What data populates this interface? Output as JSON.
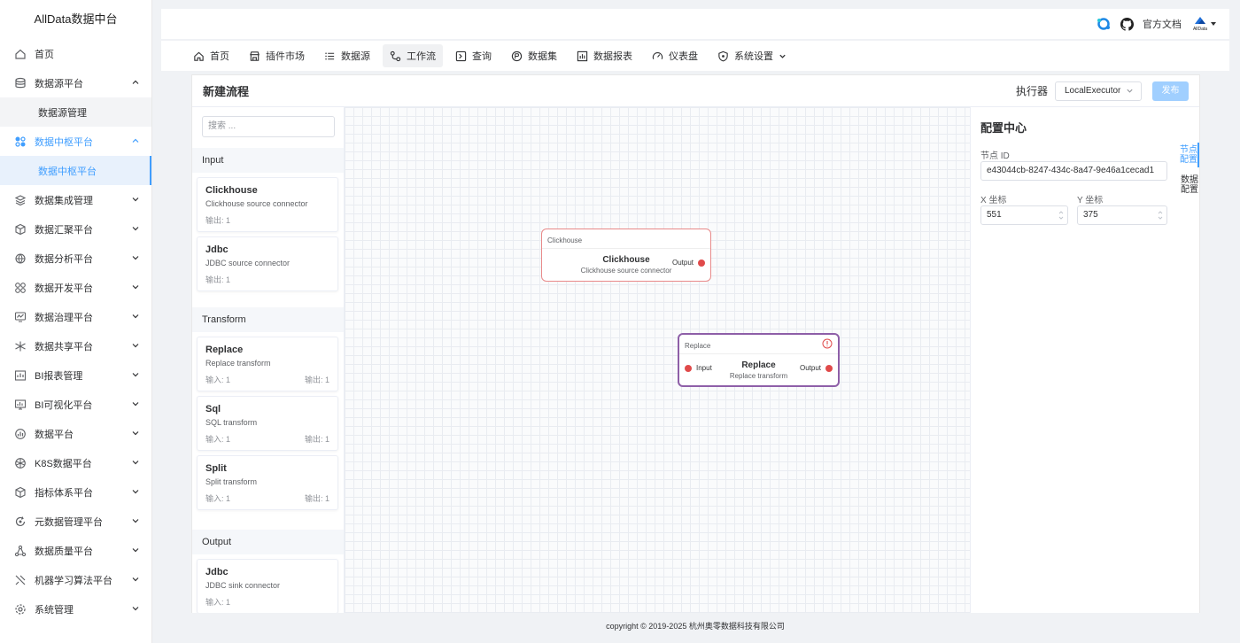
{
  "app": {
    "title": "AllData数据中台"
  },
  "sidebar": {
    "items": [
      {
        "label": "首页"
      },
      {
        "label": "数据源平台"
      },
      {
        "label": "数据源管理"
      },
      {
        "label": "数据中枢平台"
      },
      {
        "label": "数据中枢平台"
      },
      {
        "label": "数据集成管理"
      },
      {
        "label": "数据汇聚平台"
      },
      {
        "label": "数据分析平台"
      },
      {
        "label": "数据开发平台"
      },
      {
        "label": "数据治理平台"
      },
      {
        "label": "数据共享平台"
      },
      {
        "label": "BI报表管理"
      },
      {
        "label": "BI可视化平台"
      },
      {
        "label": "数据平台"
      },
      {
        "label": "K8S数据平台"
      },
      {
        "label": "指标体系平台"
      },
      {
        "label": "元数据管理平台"
      },
      {
        "label": "数据质量平台"
      },
      {
        "label": "机器学习算法平台"
      },
      {
        "label": "系统管理"
      }
    ]
  },
  "header": {
    "docs_label": "官方文档",
    "logo_text": "AllData"
  },
  "menu": {
    "items": [
      {
        "label": "首页"
      },
      {
        "label": "插件市场"
      },
      {
        "label": "数据源"
      },
      {
        "label": "工作流"
      },
      {
        "label": "查询"
      },
      {
        "label": "数据集"
      },
      {
        "label": "数据报表"
      },
      {
        "label": "仪表盘"
      },
      {
        "label": "系统设置"
      }
    ]
  },
  "editor": {
    "title": "新建流程",
    "executor_label": "执行器",
    "executor_value": "LocalExecutor",
    "publish_label": "发布"
  },
  "palette": {
    "search_placeholder": "搜索 ...",
    "groups": [
      {
        "name": "Input",
        "items": [
          {
            "name": "Clickhouse",
            "desc": "Clickhouse source connector",
            "out": "输出: 1"
          },
          {
            "name": "Jdbc",
            "desc": "JDBC source connector",
            "out": "输出: 1"
          }
        ]
      },
      {
        "name": "Transform",
        "items": [
          {
            "name": "Replace",
            "desc": "Replace transform",
            "in": "输入: 1",
            "out": "输出: 1"
          },
          {
            "name": "Sql",
            "desc": "SQL transform",
            "in": "输入: 1",
            "out": "输出: 1"
          },
          {
            "name": "Split",
            "desc": "Split transform",
            "in": "输入: 1",
            "out": "输出: 1"
          }
        ]
      },
      {
        "name": "Output",
        "items": [
          {
            "name": "Jdbc",
            "desc": "JDBC sink connector",
            "in": "输入: 1"
          }
        ]
      }
    ]
  },
  "canvas": {
    "nodes": [
      {
        "header": "Clickhouse",
        "name": "Clickhouse",
        "desc": "Clickhouse source connector",
        "output": "Output",
        "border": "#e88a8a"
      },
      {
        "header": "Replace",
        "name": "Replace",
        "desc": "Replace transform",
        "input": "Input",
        "output": "Output",
        "border": "#8e5fa8"
      }
    ]
  },
  "config": {
    "title": "配置中心",
    "node_id_label": "节点 ID",
    "node_id_value": "e43044cb-8247-434c-8a47-9e46a1cecad1",
    "x_label": "X 坐标",
    "x_value": "551",
    "y_label": "Y 坐标",
    "y_value": "375",
    "tab_node": "节点配置",
    "tab_data": "数据配置"
  },
  "footer": {
    "text": "copyright © 2019-2025 杭州奥零数据科技有限公司"
  },
  "colors": {
    "accent": "#409eff",
    "port": "#e04a4a"
  }
}
